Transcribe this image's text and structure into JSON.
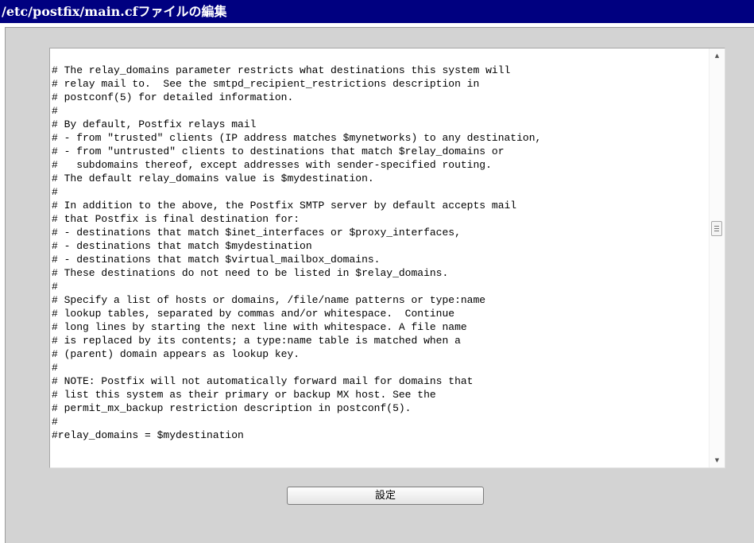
{
  "title": "/etc/postfix/main.cfファイルの編集",
  "editor": {
    "content": "# The relay_domains parameter restricts what destinations this system will\n# relay mail to.  See the smtpd_recipient_restrictions description in\n# postconf(5) for detailed information.\n#\n# By default, Postfix relays mail\n# - from \"trusted\" clients (IP address matches $mynetworks) to any destination,\n# - from \"untrusted\" clients to destinations that match $relay_domains or\n#   subdomains thereof, except addresses with sender-specified routing.\n# The default relay_domains value is $mydestination.\n#\n# In addition to the above, the Postfix SMTP server by default accepts mail\n# that Postfix is final destination for:\n# - destinations that match $inet_interfaces or $proxy_interfaces,\n# - destinations that match $mydestination\n# - destinations that match $virtual_mailbox_domains.\n# These destinations do not need to be listed in $relay_domains.\n#\n# Specify a list of hosts or domains, /file/name patterns or type:name\n# lookup tables, separated by commas and/or whitespace.  Continue\n# long lines by starting the next line with whitespace. A file name\n# is replaced by its contents; a type:name table is matched when a\n# (parent) domain appears as lookup key.\n#\n# NOTE: Postfix will not automatically forward mail for domains that\n# list this system as their primary or backup MX host. See the\n# permit_mx_backup restriction description in postconf(5).\n#\n#relay_domains = $mydestination"
  },
  "scrollbar": {
    "up_icon": "▲",
    "down_icon": "▼",
    "position_fraction": 0.5
  },
  "button": {
    "label": "設定"
  }
}
